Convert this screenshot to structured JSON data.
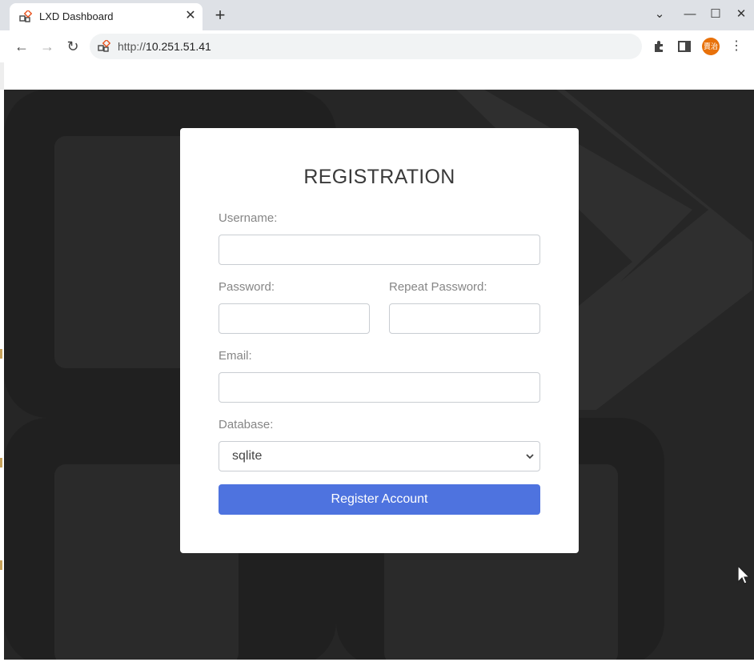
{
  "browser": {
    "tab_title": "LXD Dashboard",
    "tab_close": "✕",
    "new_tab": "+",
    "url_scheme": "http://",
    "url_host": "10.251.51.41",
    "profile_initials": "賣治",
    "controls": {
      "tab_list": "⌄",
      "minimize": "—",
      "maximize": "☐",
      "close": "✕"
    },
    "icons": {
      "back": "←",
      "forward": "→",
      "reload": "↻",
      "extensions": "puzzle-icon",
      "side_panel": "side-panel-icon",
      "menu": "⋮"
    }
  },
  "form": {
    "title": "REGISTRATION",
    "username_label": "Username:",
    "username_value": "",
    "password_label": "Password:",
    "password_value": "",
    "repeat_password_label": "Repeat Password:",
    "repeat_password_value": "",
    "email_label": "Email:",
    "email_value": "",
    "database_label": "Database:",
    "database_selected": "sqlite",
    "submit_label": "Register Account"
  },
  "colors": {
    "page_bg": "#262626",
    "accent": "#4e73df",
    "profile": "#e8710a"
  }
}
